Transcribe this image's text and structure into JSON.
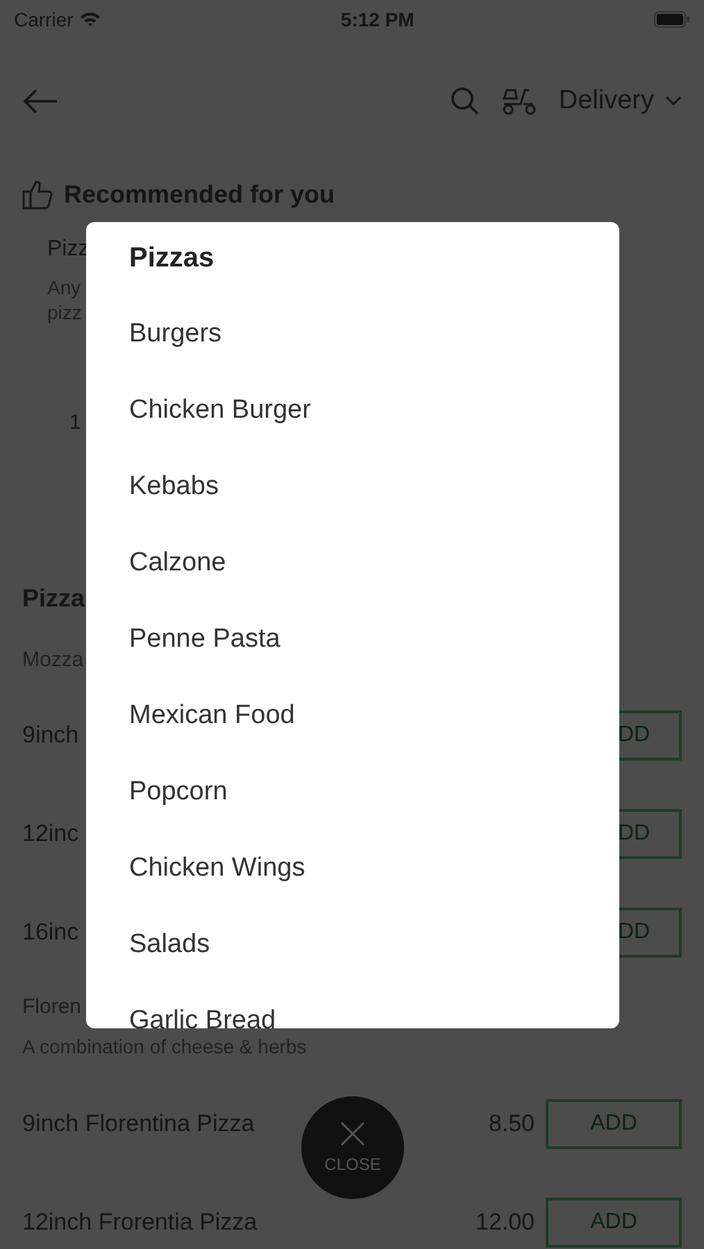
{
  "status_bar": {
    "carrier": "Carrier",
    "time": "5:12 PM"
  },
  "header": {
    "delivery_label": "Delivery"
  },
  "recommended": {
    "title": "Recommended for you",
    "card": {
      "title": "Pizz",
      "description_lines": [
        "Any",
        "pizz"
      ],
      "price": "1"
    }
  },
  "category": {
    "title": "Pizza",
    "groups": [
      {
        "title": "Mozza",
        "items": [
          {
            "name": "9inch",
            "add_label": "DD"
          },
          {
            "name": "12inc",
            "add_label": "DD"
          },
          {
            "name": "16inc",
            "add_label": "DD"
          }
        ]
      },
      {
        "title": "Floren",
        "description": "A combination of cheese & herbs",
        "items": [
          {
            "name": "9inch Florentina Pizza",
            "price": "8.50",
            "add_label": "ADD"
          },
          {
            "name": "12inch Frorentia Pizza",
            "price": "12.00",
            "add_label": "ADD"
          }
        ]
      }
    ]
  },
  "category_menu": {
    "title": "Pizzas",
    "items": [
      "Burgers",
      "Chicken Burger",
      "Kebabs",
      "Calzone",
      "Penne Pasta",
      "Mexican Food",
      "Popcorn",
      "Chicken Wings",
      "Salads",
      "Garlic Bread"
    ]
  },
  "close_button": {
    "label": "CLOSE"
  }
}
